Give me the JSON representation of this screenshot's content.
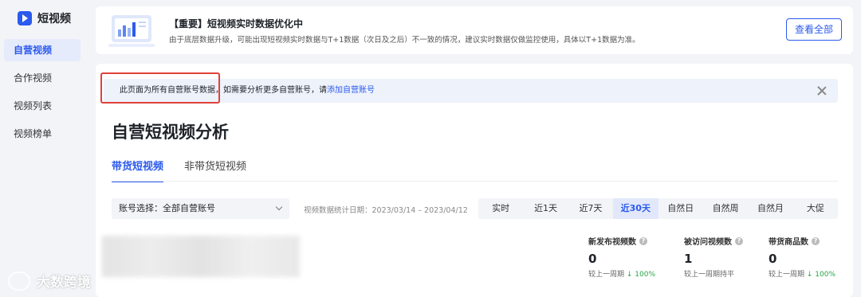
{
  "brand": {
    "title": "短视频",
    "icon": "play-icon"
  },
  "sidebar": {
    "items": [
      {
        "label": "自营视频",
        "active": true
      },
      {
        "label": "合作视频",
        "active": false
      },
      {
        "label": "视频列表",
        "active": false
      },
      {
        "label": "视频榜单",
        "active": false
      }
    ]
  },
  "banner": {
    "title": "【重要】短视频实时数据优化中",
    "desc": "由于底层数据升级，可能出现短视频实时数据与T+1数据（次日及之后）不一致的情况，建议实时数据仅做监控使用，具体以T+1数据为准。",
    "button_label": "查看全部"
  },
  "notice": {
    "text": "此页面为所有自营账号数据，如需要分析更多自营账号，请",
    "link": "添加自营账号"
  },
  "page_title": "自营短视频分析",
  "tabs": [
    {
      "label": "带货短视频",
      "active": true
    },
    {
      "label": "非带货短视频",
      "active": false
    }
  ],
  "filters": {
    "account_label": "账号选择：全部自营账号",
    "date_range": "视频数据统计日期：2023/03/14 – 2023/04/12",
    "ranges": [
      {
        "label": "实时",
        "active": false
      },
      {
        "label": "近1天",
        "active": false
      },
      {
        "label": "近7天",
        "active": false
      },
      {
        "label": "近30天",
        "active": true
      },
      {
        "label": "自然日",
        "active": false
      },
      {
        "label": "自然周",
        "active": false
      },
      {
        "label": "自然月",
        "active": false
      },
      {
        "label": "大促",
        "active": false
      }
    ]
  },
  "stats": [
    {
      "label": "新发布视频数",
      "value": "0",
      "compare": "较上一周期",
      "change": "↓ 100%"
    },
    {
      "label": "被访问视频数",
      "value": "1",
      "compare": "较上一周期持平",
      "change": ""
    },
    {
      "label": "带货商品数",
      "value": "0",
      "compare": "较上一周期",
      "change": "↓ 100%"
    }
  ],
  "watermark": {
    "text": "大数跨境"
  },
  "colors": {
    "accent": "#2b5aed",
    "highlight": "#e0413a",
    "positive": "#28a745"
  }
}
